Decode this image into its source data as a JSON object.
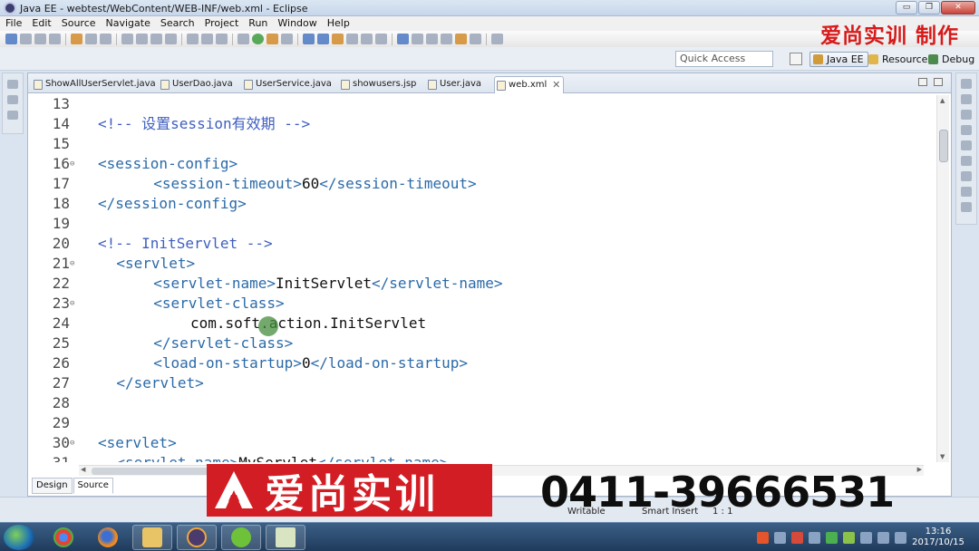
{
  "window": {
    "title": "Java EE - webtest/WebContent/WEB-INF/web.xml - Eclipse",
    "controls": [
      "▭",
      "❐",
      "✕"
    ]
  },
  "menu": [
    "File",
    "Edit",
    "Source",
    "Navigate",
    "Search",
    "Project",
    "Run",
    "Window",
    "Help"
  ],
  "watermark_top": "爱尚实训 制作",
  "quick_access_placeholder": "Quick Access",
  "perspectives": [
    {
      "label": "Java EE",
      "active": true
    },
    {
      "label": "Resource",
      "active": false
    },
    {
      "label": "Debug",
      "active": false
    }
  ],
  "tabs": [
    {
      "label": "ShowAllUserServlet.java",
      "active": false
    },
    {
      "label": "UserDao.java",
      "active": false
    },
    {
      "label": "UserService.java",
      "active": false
    },
    {
      "label": "showusers.jsp",
      "active": false
    },
    {
      "label": "User.java",
      "active": false
    },
    {
      "label": "web.xml",
      "active": true
    }
  ],
  "code_lines": [
    {
      "n": "13",
      "fold": "",
      "indent": 0,
      "parts": []
    },
    {
      "n": "14",
      "fold": "",
      "indent": 0,
      "parts": [
        {
          "t": "<!-- 设置session有效期 -->",
          "c": "cmt"
        }
      ]
    },
    {
      "n": "15",
      "fold": "",
      "indent": 0,
      "parts": []
    },
    {
      "n": "16",
      "fold": "⊖",
      "indent": 0,
      "parts": [
        {
          "t": "<session-config>",
          "c": "tag"
        }
      ]
    },
    {
      "n": "17",
      "fold": "",
      "indent": 6,
      "parts": [
        {
          "t": "<session-timeout>",
          "c": "tag"
        },
        {
          "t": "60",
          "c": "txt"
        },
        {
          "t": "</session-timeout>",
          "c": "tag"
        }
      ]
    },
    {
      "n": "18",
      "fold": "",
      "indent": 0,
      "parts": [
        {
          "t": "</session-config>",
          "c": "tag"
        }
      ]
    },
    {
      "n": "19",
      "fold": "",
      "indent": 0,
      "parts": []
    },
    {
      "n": "20",
      "fold": "",
      "indent": 0,
      "parts": [
        {
          "t": "<!-- InitServlet -->",
          "c": "cmt"
        }
      ]
    },
    {
      "n": "21",
      "fold": "⊖",
      "indent": 2,
      "parts": [
        {
          "t": "<servlet>",
          "c": "tag"
        }
      ]
    },
    {
      "n": "22",
      "fold": "",
      "indent": 6,
      "parts": [
        {
          "t": "<servlet-name>",
          "c": "tag"
        },
        {
          "t": "InitServlet",
          "c": "txt"
        },
        {
          "t": "</servlet-name>",
          "c": "tag"
        }
      ]
    },
    {
      "n": "23",
      "fold": "⊖",
      "indent": 6,
      "parts": [
        {
          "t": "<servlet-class>",
          "c": "tag"
        }
      ]
    },
    {
      "n": "24",
      "fold": "",
      "indent": 10,
      "parts": [
        {
          "t": "com.soft.action.InitServlet",
          "c": "txt"
        }
      ]
    },
    {
      "n": "25",
      "fold": "",
      "indent": 6,
      "parts": [
        {
          "t": "</servlet-class>",
          "c": "tag"
        }
      ]
    },
    {
      "n": "26",
      "fold": "",
      "indent": 6,
      "parts": [
        {
          "t": "<load-on-startup>",
          "c": "tag"
        },
        {
          "t": "0",
          "c": "txt"
        },
        {
          "t": "</load-on-startup>",
          "c": "tag"
        }
      ]
    },
    {
      "n": "27",
      "fold": "",
      "indent": 2,
      "parts": [
        {
          "t": "</servlet>",
          "c": "tag"
        }
      ]
    },
    {
      "n": "28",
      "fold": "",
      "indent": 0,
      "parts": []
    },
    {
      "n": "29",
      "fold": "",
      "indent": 0,
      "parts": []
    },
    {
      "n": "30",
      "fold": "⊖",
      "indent": 0,
      "parts": [
        {
          "t": "<servlet>",
          "c": "tag"
        }
      ]
    },
    {
      "n": "31",
      "fold": "",
      "indent": 2,
      "parts": [
        {
          "t": "<servlet-name>",
          "c": "tag"
        },
        {
          "t": "MyServlet",
          "c": "txt"
        },
        {
          "t": "</servlet-name>",
          "c": "tag"
        }
      ]
    }
  ],
  "editor_bottom_tabs": [
    {
      "label": "Design",
      "active": false
    },
    {
      "label": "Source",
      "active": true
    }
  ],
  "status": {
    "writable": "Writable",
    "insert_mode": "Smart Insert",
    "position": "1 : 1"
  },
  "overlay": {
    "brand_name": "爱尚实训",
    "phone": "0411-39666531"
  },
  "taskbar": {
    "time": "13:16",
    "date": "2017/10/15"
  }
}
